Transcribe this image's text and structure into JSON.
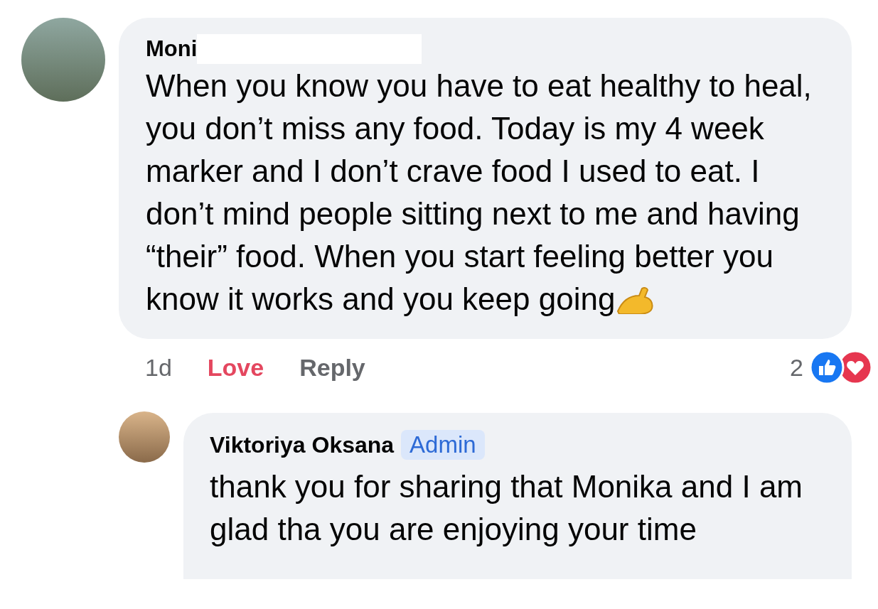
{
  "comments": [
    {
      "author": "Moni",
      "author_redacted": true,
      "text": "When you know you have to eat healthy to heal, you don’t miss any food. Today is my 4 week marker and I don’t crave food I used to eat. I don’t mind people sitting next to me and having “their” food. When you start feeling better you know it works and you keep going",
      "time": "1d",
      "actions": [
        {
          "label": "Love",
          "selected": true
        },
        {
          "label": "Reply",
          "selected": false
        }
      ],
      "reaction_count": "2",
      "reactions": [
        {
          "kind": "like"
        },
        {
          "kind": "love"
        }
      ]
    },
    {
      "author": "Viktoriya Oksana",
      "badge": "Admin",
      "text": "thank you for sharing that Monika and I am glad tha you are enjoying your time"
    }
  ]
}
